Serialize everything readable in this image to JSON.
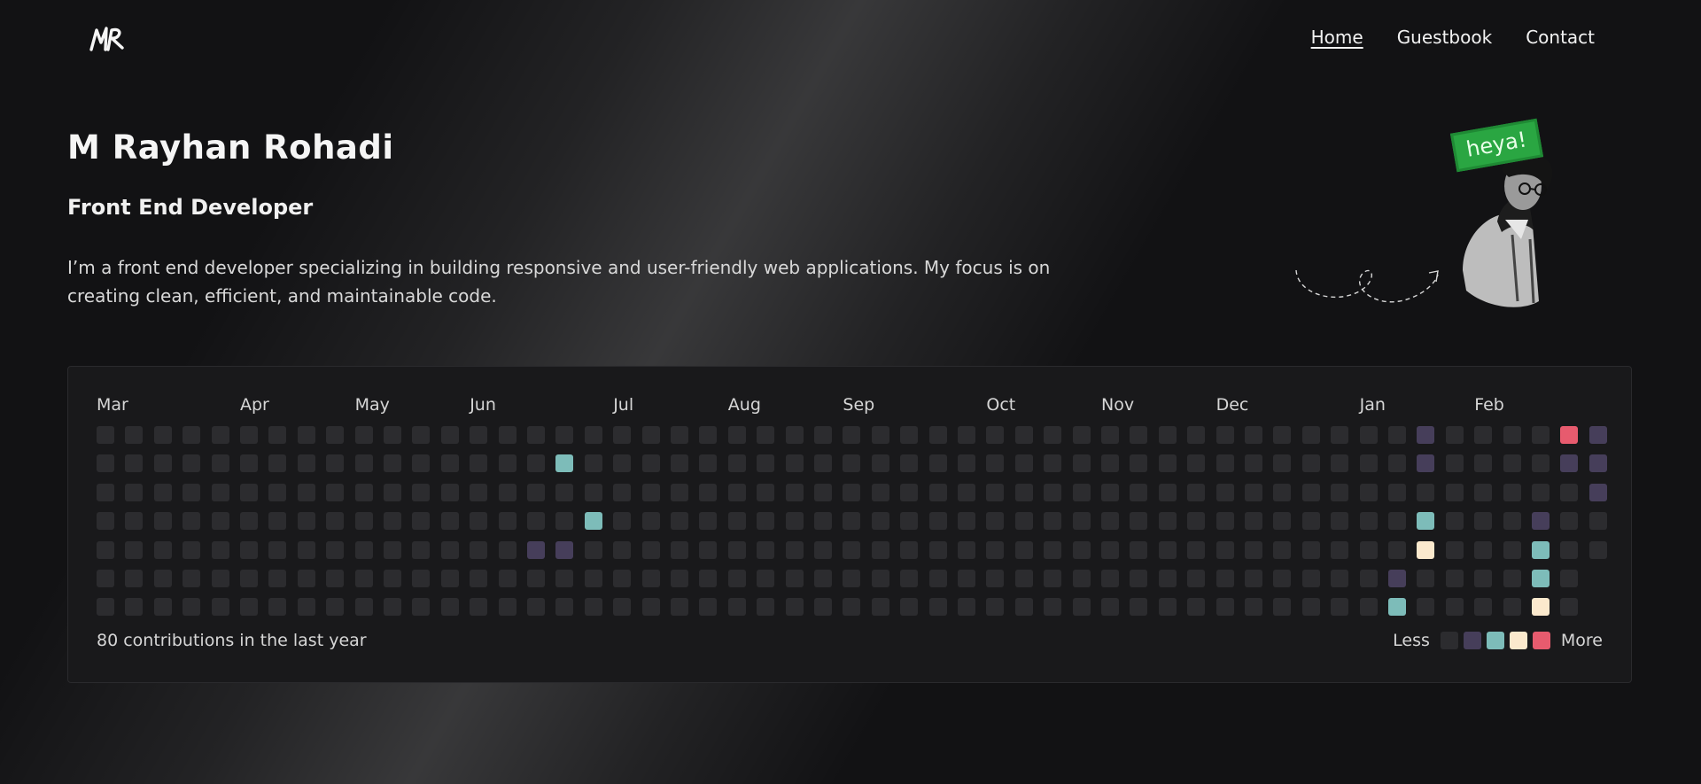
{
  "header": {
    "logo_text": "MR",
    "nav": [
      {
        "label": "Home",
        "active": true
      },
      {
        "label": "Guestbook",
        "active": false
      },
      {
        "label": "Contact",
        "active": false
      }
    ]
  },
  "hero": {
    "name": "M Rayhan Rohadi",
    "role": "Front End Developer",
    "bio": "I’m a front end developer specializing in building responsive and user-friendly web applications. My focus is on creating clean, efficient, and maintainable code.",
    "badge": "heya!"
  },
  "contributions": {
    "months": [
      "Mar",
      "Apr",
      "May",
      "Jun",
      "Jul",
      "Aug",
      "Sep",
      "Oct",
      "Nov",
      "Dec",
      "Jan",
      "Feb"
    ],
    "month_start_week": [
      0,
      5,
      9,
      13,
      18,
      22,
      26,
      31,
      35,
      39,
      44,
      48
    ],
    "weeks": 53,
    "last_week_days": 5,
    "active_cells": [
      {
        "week": 16,
        "day": 1,
        "level": 2
      },
      {
        "week": 16,
        "day": 4,
        "level": 1
      },
      {
        "week": 15,
        "day": 4,
        "level": 1
      },
      {
        "week": 17,
        "day": 3,
        "level": 2
      },
      {
        "week": 46,
        "day": 0,
        "level": 1
      },
      {
        "week": 46,
        "day": 1,
        "level": 1
      },
      {
        "week": 46,
        "day": 3,
        "level": 2
      },
      {
        "week": 46,
        "day": 4,
        "level": 3
      },
      {
        "week": 45,
        "day": 5,
        "level": 1
      },
      {
        "week": 45,
        "day": 6,
        "level": 2
      },
      {
        "week": 50,
        "day": 3,
        "level": 1
      },
      {
        "week": 50,
        "day": 4,
        "level": 2
      },
      {
        "week": 50,
        "day": 5,
        "level": 2
      },
      {
        "week": 50,
        "day": 6,
        "level": 3
      },
      {
        "week": 51,
        "day": 0,
        "level": 4
      },
      {
        "week": 51,
        "day": 1,
        "level": 1
      },
      {
        "week": 52,
        "day": 0,
        "level": 1
      },
      {
        "week": 52,
        "day": 1,
        "level": 1
      },
      {
        "week": 52,
        "day": 2,
        "level": 1
      }
    ],
    "level_colors": [
      "#2c2c2f",
      "#463e5a",
      "#7dbcb9",
      "#fbe9cd",
      "#e75b6e"
    ],
    "summary": "80 contributions in the last year",
    "legend_less": "Less",
    "legend_more": "More"
  }
}
